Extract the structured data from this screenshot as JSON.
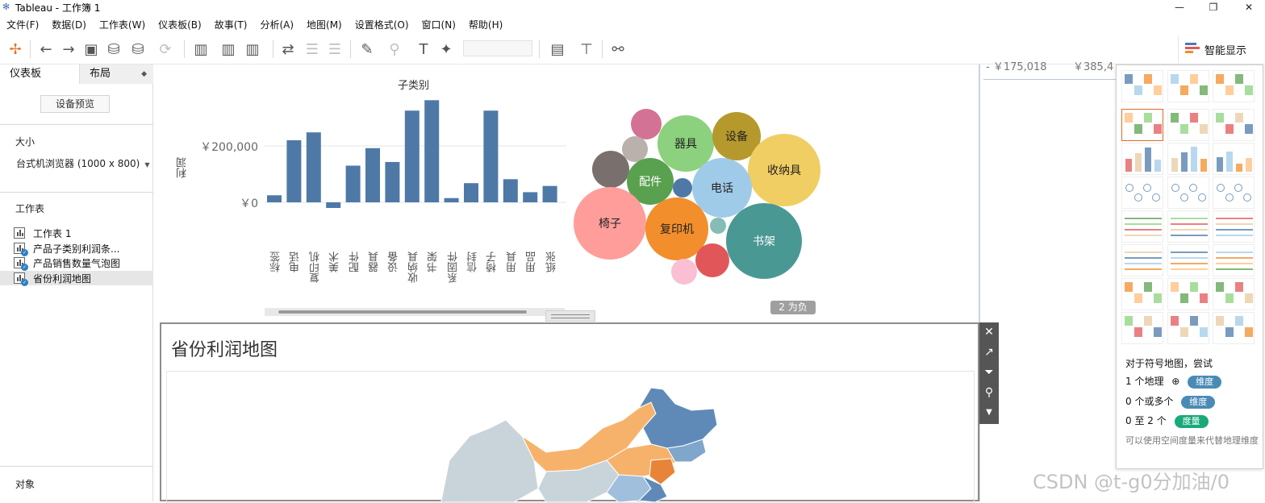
{
  "window": {
    "title": "Tableau - 工作簿 1",
    "minimize": "—",
    "maximize": "❐",
    "close": "✕"
  },
  "menu": [
    "文件(F)",
    "数据(D)",
    "工作表(W)",
    "仪表板(B)",
    "故事(T)",
    "分析(A)",
    "地图(M)",
    "设置格式(O)",
    "窗口(N)",
    "帮助(H)"
  ],
  "toolbar": {
    "smart_show": "智能显示"
  },
  "left_panel": {
    "tab_dashboard": "仪表板",
    "tab_layout": "布局",
    "device_preview": "设备预览",
    "size_heading": "大小",
    "size_value": "台式机浏览器 (1000 x 800)",
    "sheets_heading": "工作表",
    "sheets": [
      {
        "label": "工作表 1",
        "used": false
      },
      {
        "label": "产品子类别利润条...",
        "used": true
      },
      {
        "label": "产品销售数量气泡图",
        "used": true
      },
      {
        "label": "省份利润地图",
        "used": true,
        "selected": true
      }
    ],
    "objects_heading": "对象"
  },
  "chart_data": [
    {
      "type": "bar",
      "title": "子类别",
      "ylabel": "利润",
      "ytick_labels": [
        "￥200,000",
        "￥0"
      ],
      "ylim": [
        -25000,
        400000
      ],
      "categories": [
        "标签",
        "电话",
        "复印机",
        "美术",
        "配件",
        "器具",
        "设备",
        "收纳具",
        "书架",
        "系固件",
        "信封",
        "椅子",
        "用具",
        "用品",
        "纸张"
      ],
      "values": [
        25000,
        220000,
        248000,
        -20000,
        130000,
        192000,
        143000,
        325000,
        362000,
        15000,
        68000,
        325000,
        82000,
        36000,
        58000
      ],
      "color": "#4e79a7"
    },
    {
      "type": "bubble",
      "labels": [
        "器具",
        "设备",
        "收纳具",
        "配件",
        "电话",
        "椅子",
        "复印机",
        "书架"
      ],
      "negative_badge": "2 为负"
    }
  ],
  "partial_numbers": [
    "- ￥175,018",
    "￥385,4"
  ],
  "map_sheet": {
    "title": "省份利润地图"
  },
  "show_me": {
    "hint": "对于符号地图，尝试",
    "req1_text": "1 个地理",
    "req1_pill": "维度",
    "req2_text": "0 个或多个",
    "req2_pill": "维度",
    "req3_text": "0 至 2 个",
    "req3_pill": "度量",
    "note": "可以使用空间度量来代替地理维度"
  },
  "watermark": "CSDN @t-g0分加油/0"
}
